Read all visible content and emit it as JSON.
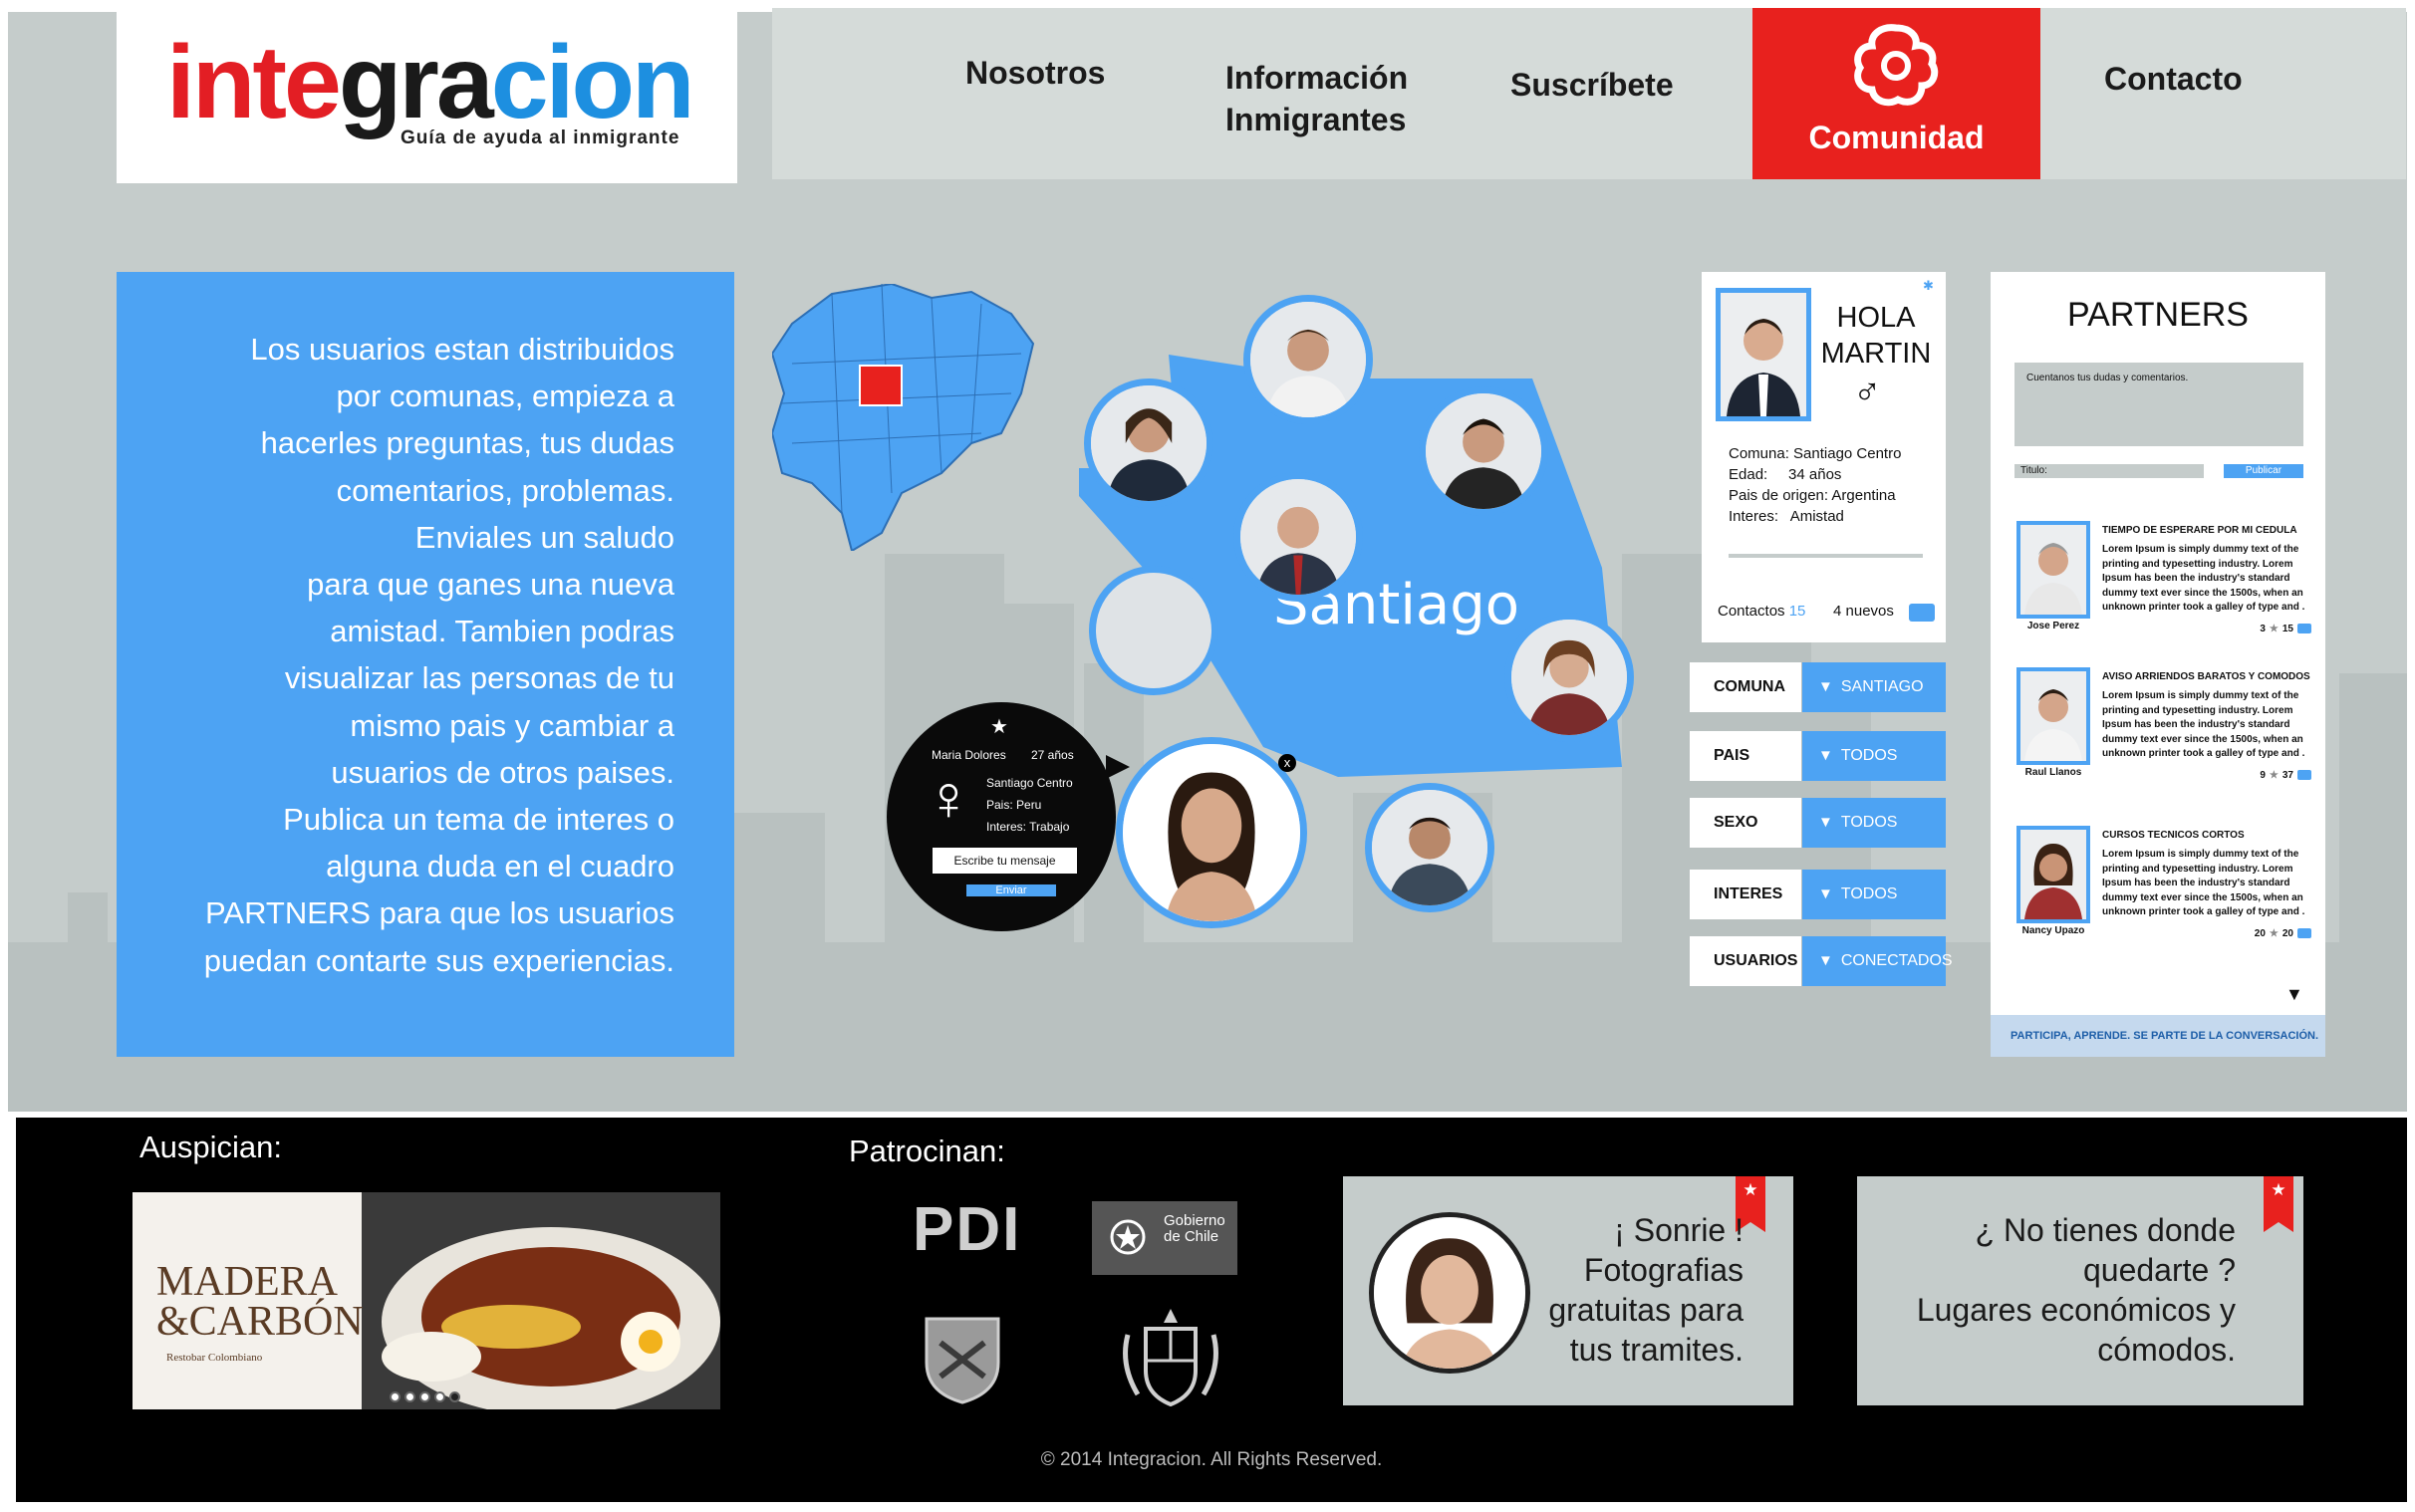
{
  "brand": {
    "logo_part1": "inte",
    "logo_part2": "gra",
    "logo_part3": "cion",
    "tagline": "Guía de ayuda al inmigrante"
  },
  "nav": {
    "items": [
      {
        "label": "Nosotros"
      },
      {
        "label": "Información\nInmigrantes"
      },
      {
        "label": "Suscríbete"
      },
      {
        "label": "Comunidad",
        "active": true
      },
      {
        "label": "Contacto"
      }
    ]
  },
  "intro": {
    "text": "Los usuarios estan distribuidos por comunas, empieza a hacerles preguntas, tus dudas comentarios, problemas. Enviales un saludo para que ganes una nueva amistad. Tambien podras visualizar las personas de tu mismo pais y cambiar a usuarios de otros paises. Publica un tema de interes o alguna duda en el cuadro PARTNERS para que los usuarios puedan contarte sus experiencias.",
    "lines": [
      "Los usuarios estan distribuidos",
      "por comunas,  empieza a",
      "hacerles preguntas, tus dudas",
      "comentarios, problemas.",
      "Enviales un saludo",
      "para que ganes una nueva",
      "amistad. Tambien podras",
      "visualizar las personas de tu",
      "mismo pais y cambiar a",
      "usuarios de otros paises.",
      "Publica un tema de interes o",
      "alguna duda en el cuadro",
      "PARTNERS para que los usuarios",
      "puedan contarte sus experiencias."
    ]
  },
  "map": {
    "city_label": "Santiago",
    "popup": {
      "name": "Maria Dolores",
      "age": "27 años",
      "comuna": "Santiago Centro",
      "pais": "Pais: Peru",
      "interes": "Interes: Trabajo",
      "message_placeholder": "Escribe tu mensaje",
      "send_label": "Enviar",
      "close": "x"
    }
  },
  "profile": {
    "greeting": "HOLA",
    "name": "MARTIN",
    "gender_symbol": "♂",
    "comuna": "Comuna: Santiago Centro",
    "edad": "Edad:     34 años",
    "pais": "Pais de origen: Argentina",
    "interes": "Interes:   Amistad",
    "contacts_label": "Contactos",
    "contacts_count": "15",
    "new_label": "4 nuevos"
  },
  "filters": [
    {
      "label": "COMUNA",
      "value": "SANTIAGO"
    },
    {
      "label": "PAIS",
      "value": "TODOS"
    },
    {
      "label": "SEXO",
      "value": "TODOS"
    },
    {
      "label": "INTERES",
      "value": "TODOS"
    },
    {
      "label": "USUARIOS",
      "value": "CONECTADOS"
    }
  ],
  "partners": {
    "title": "PARTNERS",
    "input_placeholder": "Cuentanos tus dudas y comentarios.",
    "title_placeholder": "Titulo:",
    "publish_label": "Publicar",
    "footer": "PARTICIPA, APRENDE. SE PARTE DE LA CONVERSACIÓN.",
    "posts": [
      {
        "author": "Jose Perez",
        "title": "TIEMPO DE ESPERARE POR MI CEDULA",
        "body": "Lorem Ipsum is simply dummy text of the printing and typesetting industry. Lorem Ipsum has been the industry's standard dummy text ever since the 1500s, when an unknown printer took a galley of type and .",
        "stars": "3",
        "comments": "15"
      },
      {
        "author": "Raul Llanos",
        "title": "AVISO ARRIENDOS BARATOS Y COMODOS",
        "body": "Lorem Ipsum is simply dummy text of the printing and typesetting industry. Lorem Ipsum has been the industry's standard dummy text ever since the 1500s, when an unknown printer took a galley of type and .",
        "stars": "9",
        "comments": "37"
      },
      {
        "author": "Nancy Upazo",
        "title": "CURSOS TECNICOS CORTOS",
        "body": "Lorem Ipsum is simply dummy text of the printing and typesetting industry. Lorem Ipsum has been the industry's standard dummy text ever since the 1500s, when an unknown printer took a galley of type and .",
        "stars": "20",
        "comments": "20"
      }
    ]
  },
  "footer": {
    "auspician": "Auspician:",
    "patrocinan": "Patrocinan:",
    "ad": {
      "line1": "MADERA",
      "line2": "&CARBÓN",
      "sub": "Restobar Colombiano"
    },
    "sponsors": {
      "pdi": "PDI",
      "gobierno": "Gobierno\nde Chile"
    },
    "promo1": "¡ Sonrie !\nFotografias\ngratuitas para\ntus tramites.",
    "promo2": "¿ No tienes donde\nquedarte ?\nLugares económicos y\ncómodos.",
    "copyright": "© 2014 Integracion. All Rights Reserved."
  },
  "colors": {
    "accent_blue": "#4da3f3",
    "accent_red": "#e8211e",
    "background_gray": "#c5cccb"
  }
}
